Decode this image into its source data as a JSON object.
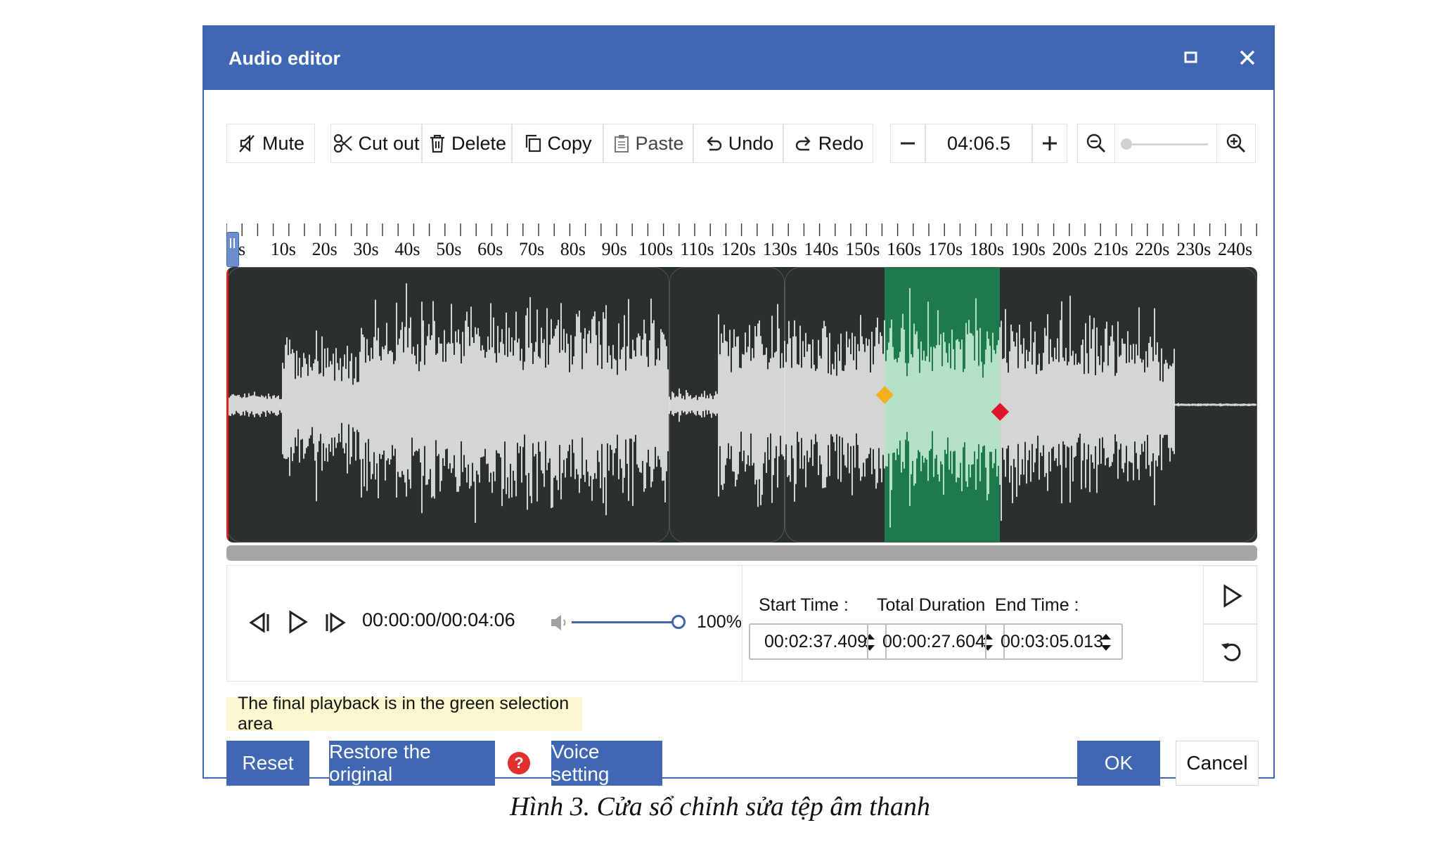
{
  "window": {
    "title": "Audio editor"
  },
  "toolbar": {
    "mute_label": "Mute",
    "cut_label": "Cut out",
    "delete_label": "Delete",
    "copy_label": "Copy",
    "paste_label": "Paste",
    "undo_label": "Undo",
    "redo_label": "Redo",
    "time_value": "04:06.5",
    "zoom_level": 0
  },
  "ruler": {
    "labels": [
      "s",
      "10s",
      "20s",
      "30s",
      "40s",
      "50s",
      "60s",
      "70s",
      "80s",
      "90s",
      "100s",
      "110s",
      "120s",
      "130s",
      "140s",
      "150s",
      "160s",
      "170s",
      "180s",
      "190s",
      "200s",
      "210s",
      "220s",
      "230s",
      "240s"
    ]
  },
  "waveform": {
    "duration_s": 246.5,
    "selection_start_s": 157.409,
    "selection_end_s": 185.013,
    "segment_boundaries_s": [
      106,
      133.5
    ]
  },
  "playback": {
    "time_text": "00:00:00/00:04:06",
    "volume_text": "100%",
    "volume_level": 1.0
  },
  "range": {
    "start_label": "Start Time :",
    "start_value": "00:02:37.409",
    "duration_label": "Total Duration",
    "duration_value": "00:00:27.604",
    "end_label": "End Time :",
    "end_value": "00:03:05.013"
  },
  "hint": "The final playback is in the green selection area",
  "buttons": {
    "reset": "Reset",
    "restore": "Restore the original",
    "voice": "Voice setting",
    "ok": "OK",
    "cancel": "Cancel"
  },
  "caption": "Hình 3. Cửa sổ chỉnh sửa tệp âm thanh",
  "colors": {
    "accent": "#4067b3",
    "selection": "#1e7a4b",
    "waveform_bg": "#2a3030",
    "start_marker": "#f2b01e",
    "end_marker": "#e0142a"
  }
}
